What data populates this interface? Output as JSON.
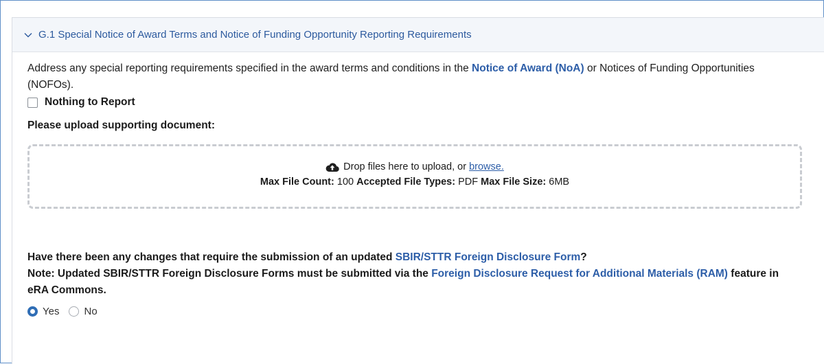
{
  "section": {
    "title": "G.1 Special Notice of Award Terms and Notice of Funding Opportunity Reporting Requirements"
  },
  "intro": {
    "text_before": "Address any special reporting requirements specified in the award terms and conditions in the ",
    "link": "Notice of Award (NoA)",
    "text_after": " or Notices of Funding Opportunities (NOFOs)."
  },
  "nothing_to_report": {
    "label": "Nothing to Report",
    "checked": false
  },
  "upload": {
    "label": "Please upload supporting document:",
    "drop_text": "Drop files here to upload, or",
    "browse_text": "browse.",
    "max_count_label": "Max File Count:",
    "max_count_value": "100",
    "types_label": "Accepted File Types:",
    "types_value": "PDF",
    "max_size_label": "Max File Size:",
    "max_size_value": "6MB"
  },
  "question": {
    "line1_before": "Have there been any changes that require the submission of an updated ",
    "line1_link": "SBIR/STTR Foreign Disclosure Form",
    "line1_after": "?",
    "note_before": "Note: Updated SBIR/STTR Foreign Disclosure Forms must be submitted via the ",
    "note_link": "Foreign Disclosure Request for Additional Materials (RAM)",
    "note_after": " feature in eRA Commons.",
    "options": [
      {
        "label": "Yes",
        "selected": true
      },
      {
        "label": "No",
        "selected": false
      }
    ]
  },
  "colors": {
    "link": "#2d5ea8",
    "header_bg": "#f3f6fa",
    "radio_selected": "#2f6db5",
    "frame_border": "#5f8fc8"
  },
  "icons": [
    "chevron-down-icon",
    "cloud-upload-icon"
  ]
}
